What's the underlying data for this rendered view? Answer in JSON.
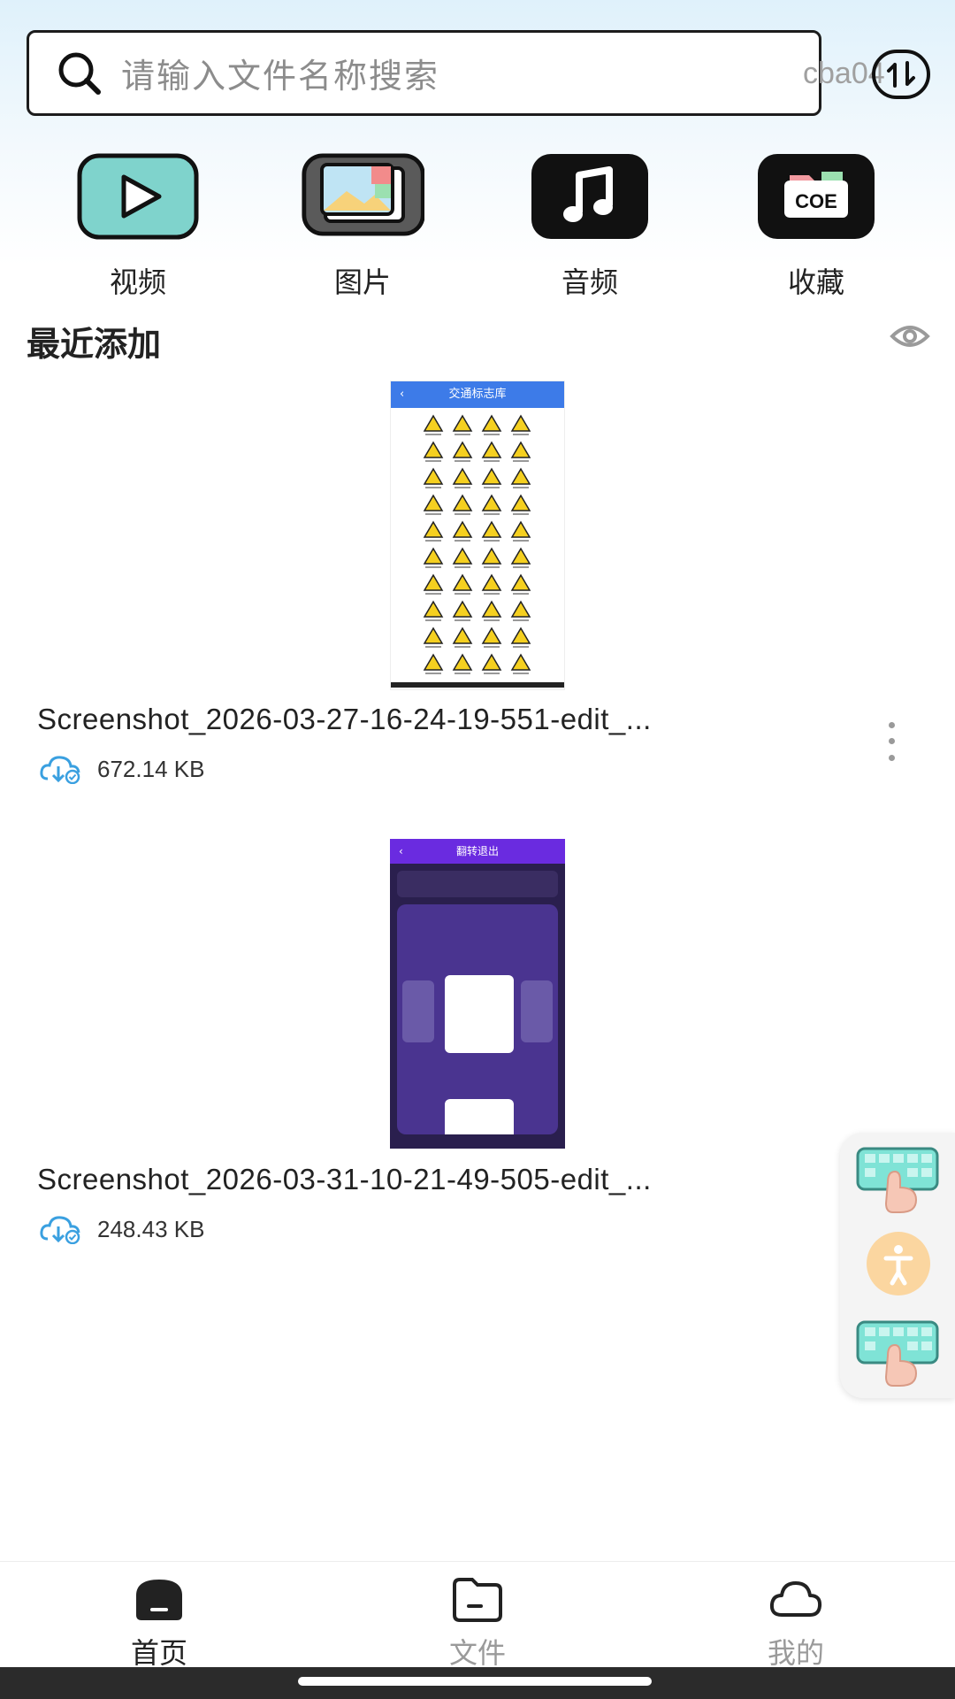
{
  "search": {
    "placeholder": "请输入文件名称搜索",
    "overlay_text": "cba04"
  },
  "categories": [
    {
      "label": "视频",
      "icon": "video-play-icon"
    },
    {
      "label": "图片",
      "icon": "image-gallery-icon"
    },
    {
      "label": "音频",
      "icon": "music-note-icon"
    },
    {
      "label": "收藏",
      "icon": "folder-coe-icon"
    }
  ],
  "categories_coe_text": "COE",
  "recent": {
    "title": "最近添加",
    "files": [
      {
        "name": "Screenshot_2026-03-27-16-24-19-551-edit_...",
        "size": "672.14 KB",
        "thumb_header": "交通标志库"
      },
      {
        "name": "Screenshot_2026-03-31-10-21-49-505-edit_...",
        "size": "248.43 KB",
        "thumb_header": "翻转退出"
      }
    ]
  },
  "nav": {
    "items": [
      {
        "label": "首页",
        "active": true
      },
      {
        "label": "文件",
        "active": false
      },
      {
        "label": "我的",
        "active": false
      }
    ]
  },
  "colors": {
    "video_tile": "#7fd3cc",
    "image_tile": "#555555",
    "music_tile": "#111111",
    "collect_tile": "#111111",
    "nav_active": "#222222",
    "nav_inactive": "#9a9a9a",
    "cloud_icon": "#3aa0e0"
  }
}
